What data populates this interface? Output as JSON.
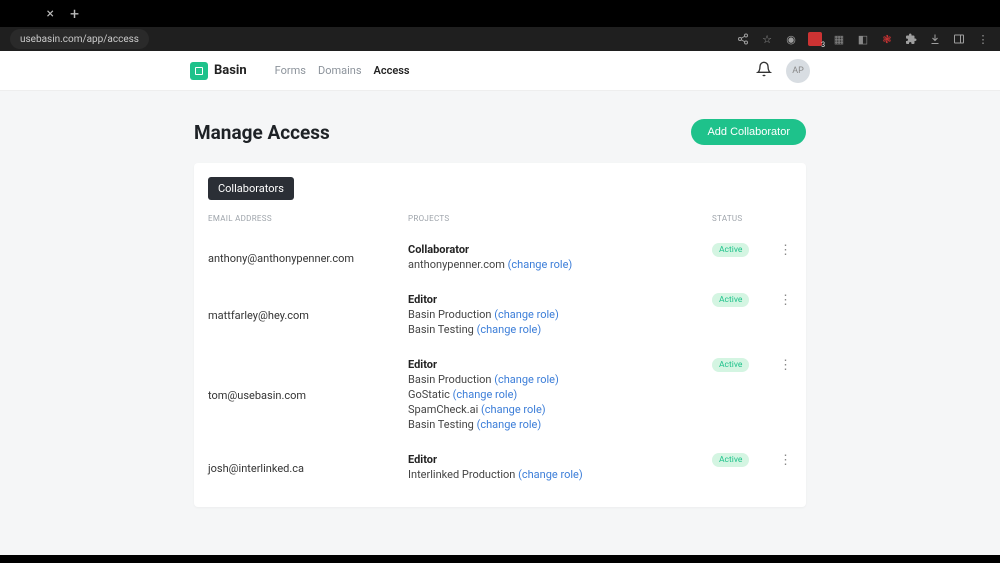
{
  "browser": {
    "url": "usebasin.com/app/access"
  },
  "header": {
    "brand": "Basin",
    "nav": [
      {
        "label": "Forms",
        "active": false
      },
      {
        "label": "Domains",
        "active": false
      },
      {
        "label": "Access",
        "active": true
      }
    ],
    "avatar_initials": "AP"
  },
  "page": {
    "title": "Manage Access",
    "add_button": "Add Collaborator",
    "tab_chip": "Collaborators",
    "columns": {
      "email": "Email Address",
      "projects": "Projects",
      "status": "Status"
    },
    "change_role_text": "(change role)",
    "rows": [
      {
        "email": "anthony@anthonypenner.com",
        "role": "Collaborator",
        "projects": [
          "anthonypenner.com"
        ],
        "status": "Active"
      },
      {
        "email": "mattfarley@hey.com",
        "role": "Editor",
        "projects": [
          "Basin Production",
          "Basin Testing"
        ],
        "status": "Active"
      },
      {
        "email": "tom@usebasin.com",
        "role": "Editor",
        "projects": [
          "Basin Production",
          "GoStatic",
          "SpamCheck.ai",
          "Basin Testing"
        ],
        "status": "Active"
      },
      {
        "email": "josh@interlinked.ca",
        "role": "Editor",
        "projects": [
          "Interlinked Production"
        ],
        "status": "Active"
      }
    ]
  }
}
